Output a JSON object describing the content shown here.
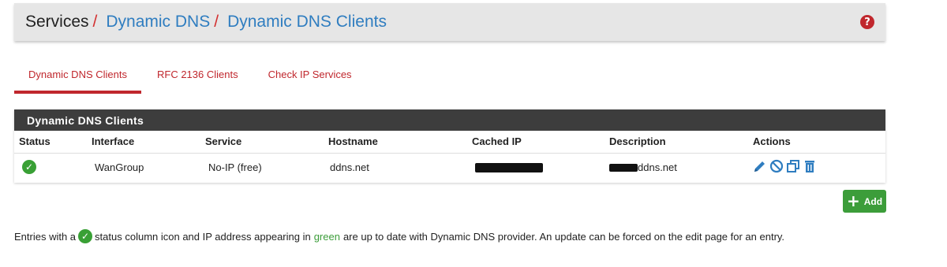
{
  "breadcrumb": {
    "root": "Services",
    "separator": "/",
    "level1": "Dynamic DNS",
    "level2": "Dynamic DNS Clients"
  },
  "help_icon": "?",
  "tabs": [
    {
      "label": "Dynamic DNS Clients",
      "active": true
    },
    {
      "label": "RFC 2136 Clients",
      "active": false
    },
    {
      "label": "Check IP Services",
      "active": false
    }
  ],
  "panel": {
    "title": "Dynamic DNS Clients",
    "columns": [
      "Status",
      "Interface",
      "Service",
      "Hostname",
      "Cached IP",
      "Description",
      "Actions"
    ],
    "rows": [
      {
        "status_icon": "check-circle-icon",
        "interface": "WanGroup",
        "service": "No-IP (free)",
        "hostname": "ddns.net",
        "cached_ip": "",
        "description": "ddns.net",
        "actions": [
          "edit-pencil-icon",
          "disable-circle-icon",
          "copy-icon",
          "delete-trash-icon"
        ]
      }
    ]
  },
  "add_button": {
    "label": "Add",
    "icon": "+"
  },
  "note": {
    "part1": "Entries with a",
    "part2": "status column icon and IP address appearing in",
    "green_word": "green",
    "part3": "are up to date with Dynamic DNS provider. An update can be forced on the edit page for an entry."
  },
  "colors": {
    "accent_red": "#c0272d",
    "link_blue": "#2f7dc0",
    "success_green": "#3c9d3a",
    "panel_heading": "#3d3d3d"
  }
}
